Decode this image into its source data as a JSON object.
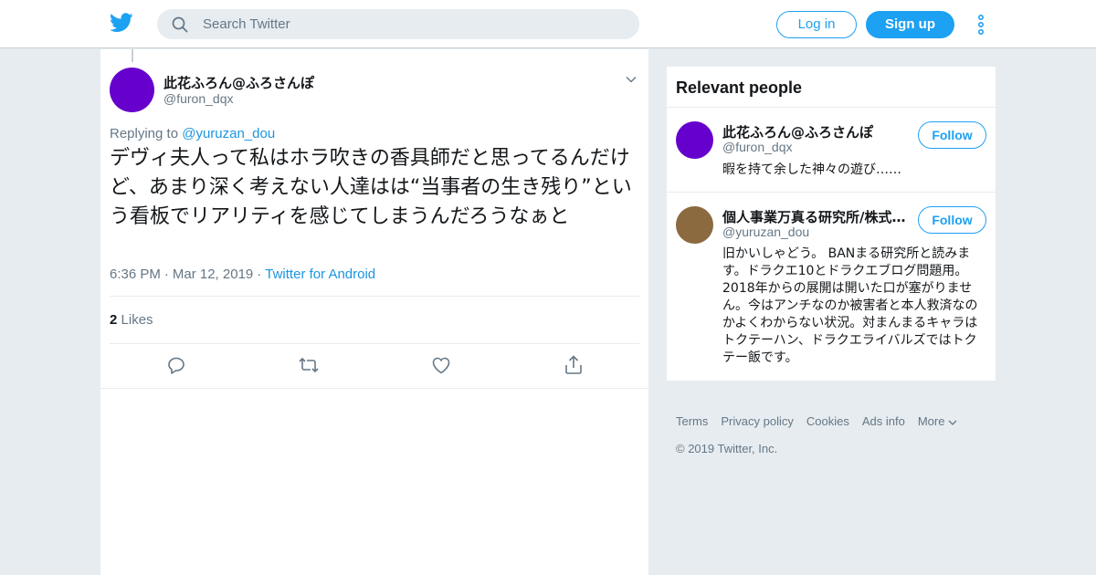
{
  "colors": {
    "brand": "#1da1f2",
    "link": "#1b95e0",
    "background": "#e6ecf0",
    "author_avatar": "#6600cc",
    "second_avatar": "#8a6a3e"
  },
  "header": {
    "logo_icon": "twitter-bird-icon",
    "search": {
      "placeholder": "Search Twitter",
      "value": "",
      "icon": "search-icon"
    },
    "login_label": "Log in",
    "signup_label": "Sign up",
    "more_icon": "vertical-dots-icon"
  },
  "tweet": {
    "author_name": "此花ふろん@ふろさんぽ",
    "author_handle": "@furon_dqx",
    "replying_prefix": "Replying to",
    "replying_to": "@yuruzan_dou",
    "text": "デヴィ夫人って私はホラ吹きの香具師だと思ってるんだけど、あまり深く考えない人達はは“当事者の生き残り”という看板でリアリティを感じてしまうんだろうなぁと",
    "time": "6:36 PM",
    "date": "Mar 12, 2019",
    "source": "Twitter for Android",
    "likes_count": "2",
    "likes_label": "Likes",
    "actions": [
      "reply-icon",
      "retweet-icon",
      "like-icon",
      "share-icon"
    ]
  },
  "relevant": {
    "title": "Relevant people",
    "people": [
      {
        "name": "此花ふろん@ふろさんぽ",
        "handle": "@furon_dqx",
        "bio": "暇を持て余した神々の遊び……",
        "follow_label": "Follow"
      },
      {
        "name": "個人事業万真る研究所/株式…",
        "handle": "@yuruzan_dou",
        "bio": "旧かいしゃどう。 BANまる研究所と読みます。ドラクエ10とドラクエブログ問題用。2018年からの展開は開いた口が塞がりません。今はアンチなのか被害者と本人救済なのかよくわからない状況。対まんまるキャラはトクテーハン、ドラクエライバルズではトクテー飯です。",
        "follow_label": "Follow"
      }
    ]
  },
  "footer": {
    "links": [
      "Terms",
      "Privacy policy",
      "Cookies",
      "Ads info",
      "More"
    ],
    "copyright": "© 2019 Twitter, Inc."
  }
}
